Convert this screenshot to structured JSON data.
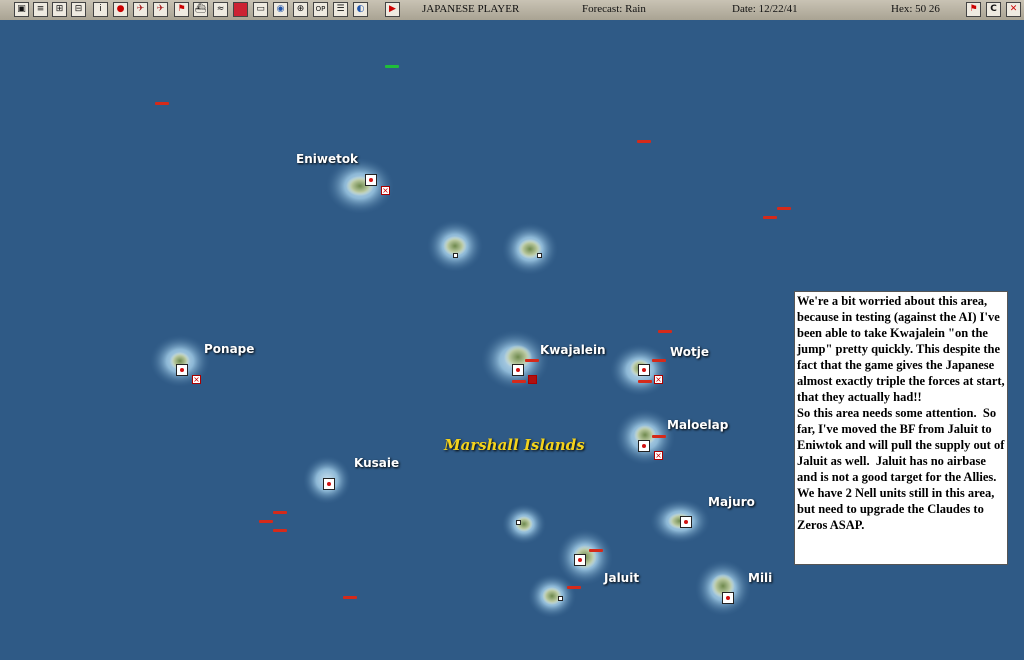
{
  "toolbar": {
    "player": "JAPANESE PLAYER",
    "forecast": "Forecast: Rain",
    "date": "Date: 12/22/41",
    "hex": "Hex: 50 26",
    "buttons": [
      "select",
      "report",
      "unit",
      "cycle",
      "info",
      "flag",
      "air",
      "air-transfer",
      "waypoint",
      "ship",
      "submarine",
      "carrier",
      "mission",
      "ground",
      "auto",
      "options",
      "op",
      "list",
      "map-overlay"
    ],
    "end_turn_label": "end-turn",
    "right_buttons": [
      "flag",
      "C",
      "X"
    ]
  },
  "map": {
    "region_label": "Marshall Islands",
    "bases": [
      {
        "name": "Eniwetok"
      },
      {
        "name": "Ponape"
      },
      {
        "name": "Kwajalein"
      },
      {
        "name": "Wotje"
      },
      {
        "name": "Maloelap"
      },
      {
        "name": "Kusaie"
      },
      {
        "name": "Majuro"
      },
      {
        "name": "Jaluit"
      },
      {
        "name": "Mili"
      }
    ]
  },
  "note": {
    "text": "We're a bit worried about this area, because in testing (against the AI) I've been able to take Kwajalein \"on the jump\" pretty quickly. This despite the fact that the game gives the Japanese almost exactly triple the forces at start, that they actually had!!\nSo this area needs some attention.  So far, I've moved the BF from Jaluit to Eniwtok and will pull the supply out of Jaluit as well.  Jaluit has no airbase and is not a good target for the Allies.  We have 2 Nell units still in this area, but need to upgrade the Claudes to Zeros ASAP."
  },
  "colors": {
    "ocean": "#2f5a86",
    "shallow": "#9ec6e0",
    "friendly_ship": "#d52a1a",
    "enemy_ship": "#1fbe3a",
    "region_label": "#f4d31c"
  }
}
